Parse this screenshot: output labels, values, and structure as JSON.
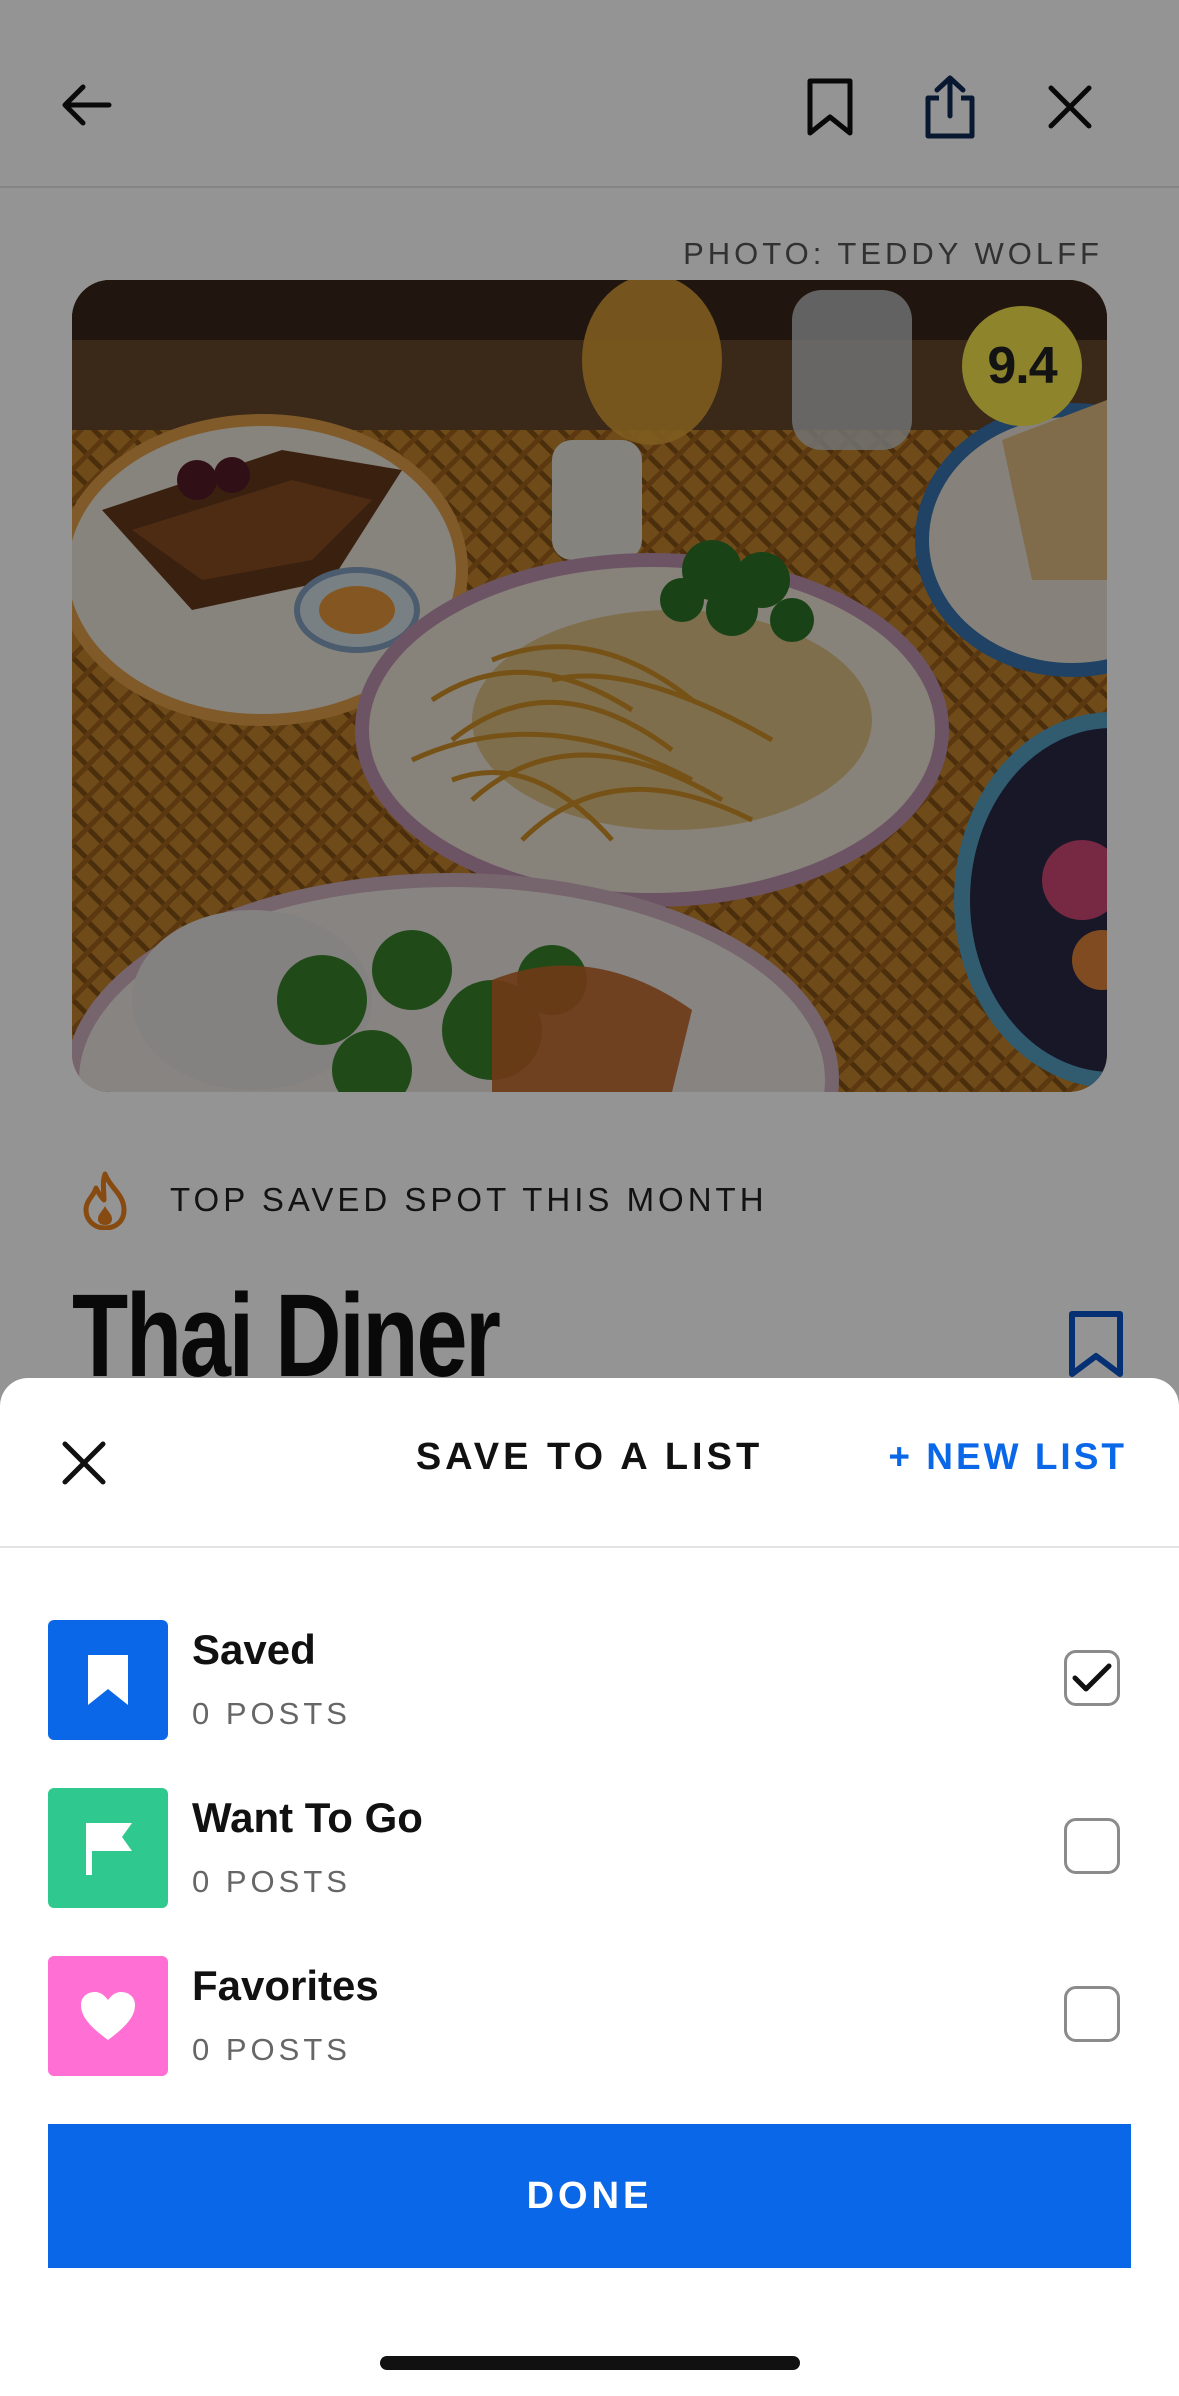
{
  "header": {
    "back_icon": "arrow-left-icon",
    "bookmark_icon": "bookmark-outline-icon",
    "share_icon": "share-icon",
    "close_icon": "close-icon"
  },
  "venue": {
    "photo_credit": "PHOTO: TEDDY WOLFF",
    "photo_desc": "food spread",
    "score": "9.4",
    "badge_label": "TOP SAVED SPOT THIS MONTH",
    "badge_icon": "flame-icon",
    "name": "Thai Diner"
  },
  "sheet": {
    "title": "SAVE TO A LIST",
    "new_list_label": "+ NEW LIST",
    "close_icon": "close-icon",
    "lists": [
      {
        "name": "Saved",
        "count": "0 POSTS",
        "icon": "bookmark-icon",
        "color": "#0a67e8",
        "checked": true
      },
      {
        "name": "Want To Go",
        "count": "0 POSTS",
        "icon": "flag-icon",
        "color": "#2fc98f",
        "checked": false
      },
      {
        "name": "Favorites",
        "count": "0 POSTS",
        "icon": "heart-icon",
        "color": "#ff6fd4",
        "checked": false
      }
    ],
    "done_label": "DONE"
  },
  "colors": {
    "accent": "#0a67e8",
    "score_badge": "#f3e34a"
  }
}
